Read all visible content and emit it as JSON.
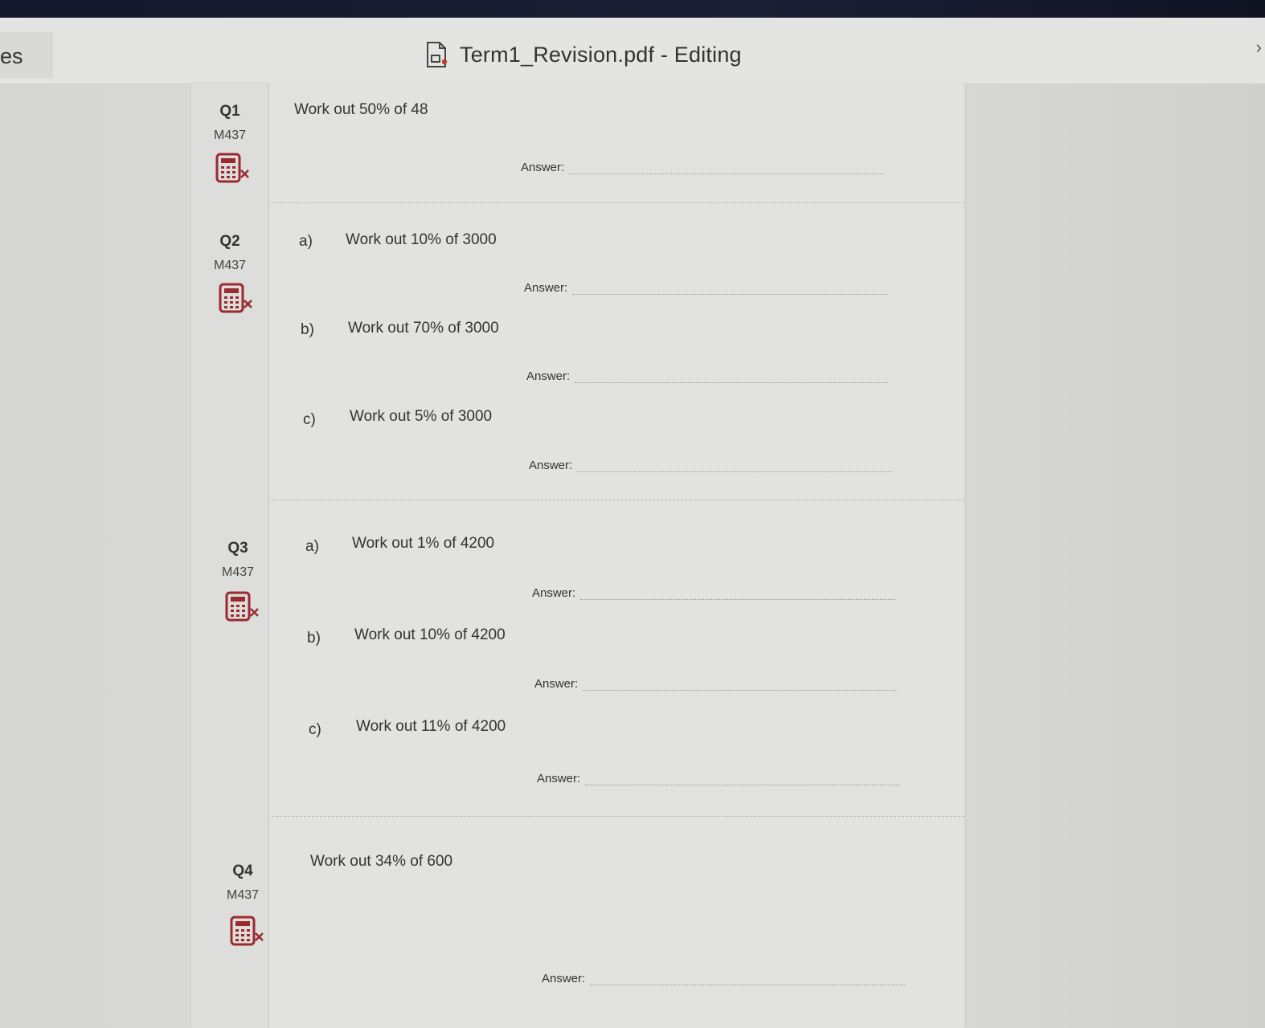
{
  "window": {
    "left_tab_text": "es",
    "title": "Term1_Revision.pdf - Editing",
    "title_icon": "pdf-file-icon"
  },
  "colors": {
    "calculator_icon": "#9b2a2f"
  },
  "questions": [
    {
      "number": "Q1",
      "code": "M437",
      "icon": "no-calculator-icon",
      "text": "Work out 50% of 48",
      "answer_label": "Answer:"
    },
    {
      "number": "Q2",
      "code": "M437",
      "icon": "no-calculator-icon",
      "parts": [
        {
          "label": "a)",
          "text": "Work out 10% of 3000",
          "answer_label": "Answer:"
        },
        {
          "label": "b)",
          "text": "Work out 70% of 3000",
          "answer_label": "Answer:"
        },
        {
          "label": "c)",
          "text": "Work out 5% of 3000",
          "answer_label": "Answer:"
        }
      ]
    },
    {
      "number": "Q3",
      "code": "M437",
      "icon": "no-calculator-icon",
      "parts": [
        {
          "label": "a)",
          "text": "Work out 1% of 4200",
          "answer_label": "Answer:"
        },
        {
          "label": "b)",
          "text": "Work out 10% of 4200",
          "answer_label": "Answer:"
        },
        {
          "label": "c)",
          "text": "Work out 11% of 4200",
          "answer_label": "Answer:"
        }
      ]
    },
    {
      "number": "Q4",
      "code": "M437",
      "icon": "no-calculator-icon",
      "text": "Work out 34% of 600",
      "answer_label": "Answer:"
    }
  ]
}
